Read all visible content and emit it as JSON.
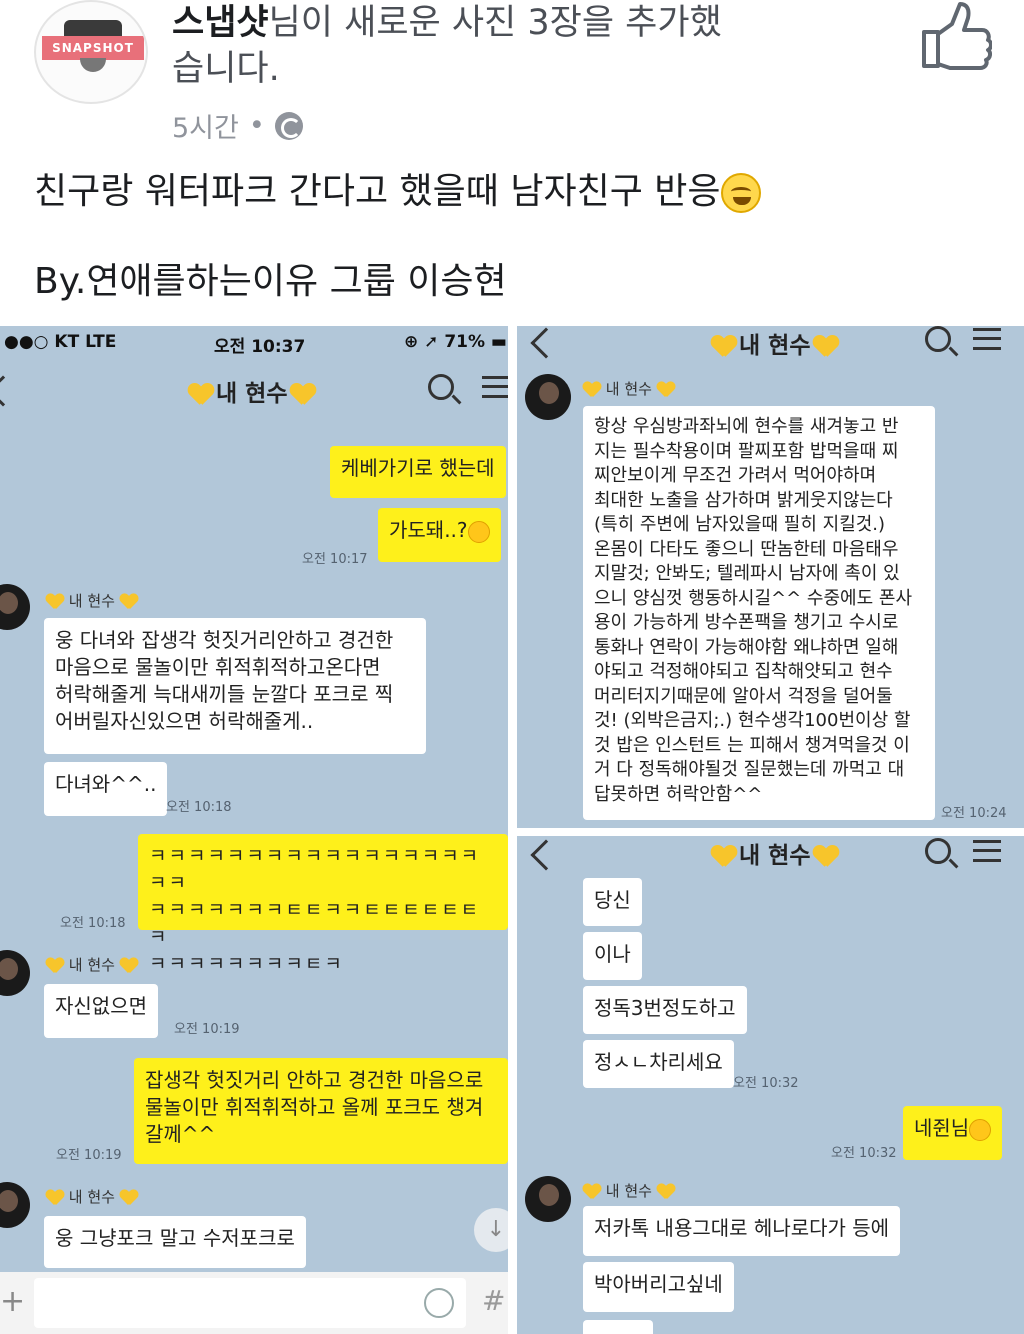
{
  "post": {
    "author": "스냅샷",
    "action": "님이 새로운 사진 3장을 추가했습니다.",
    "avatar_label": "SNAPSHOT",
    "time": "5시간",
    "separator": "•",
    "text": "친구랑 워터파크 간다고 했을때 남자친구 반응",
    "by_line": "By.연애를하는이유 그룹 이승현"
  },
  "left_chat": {
    "status": {
      "carrier": "●●○ KT  LTE",
      "time": "오전 10:37",
      "battery": "⊕ ➚ 71% ▬"
    },
    "title": "내 현수",
    "messages": [
      {
        "text": "케베가기로 했는데",
        "time": ""
      },
      {
        "text": "가도돼..?",
        "time": "오전 10:17"
      },
      {
        "sender": "내 현수",
        "text": "웅 다녀와 잡생각 헛짓거리안하고 경건한\n마음으로 물놀이만 휘적휘적하고온다면\n허락해줄게 늑대새끼들 눈깔다 포크로 찍\n어버릴자신있으면 허락해줄게..",
        "time": ""
      },
      {
        "text": "다녀와^^..",
        "time": "오전 10:18"
      },
      {
        "text": "ㅋㅋㅋㅋㅋㅋㅋㅋㅋㅋㅋㅋㅋㅋㅋㅋㅋㅋㅋ\nㅋㅋㅋㅋㅋㅋㅋㅌㅌㅋㅋㅌㅌㅌㅌㅌㅌㅋ\nㅋㅋㅋㅋㅋㅋㅋㅋㅌㅋ",
        "time": "오전 10:18"
      },
      {
        "sender": "내 현수",
        "text": "자신없으면",
        "time": "오전 10:19"
      },
      {
        "text": "잡생각 헛짓거리 안하고 경건한 마음으로\n물놀이만 휘적휘적하고 올께 포크도 챙겨\n갈께^^",
        "time": "오전 10:19"
      },
      {
        "sender": "내 현수",
        "text": "웅 그냥포크 말고 수저포크로",
        "time": ""
      }
    ],
    "scroll_icon": "↓",
    "plus_icon": "+",
    "hash_icon": "#"
  },
  "right_top_chat": {
    "title": "내 현수",
    "sender": "내 현수",
    "message": "항상 우심방과좌뇌에 현수를 새겨놓고 반\n지는 필수착용이며 팔찌포함 밥먹을때 찌\n찌안보이게 무조건 가려서 먹어야하며\n최대한 노출을 삼가하며 밝게웃지않는다\n(특히 주변에 남자있을때 필히 지킬것.)\n온몸이 다타도 좋으니 딴놈한테 마음태우\n지말것; 안봐도; 텔레파시 남자에 촉이 있\n으니 양심껏 행동하시길^^ 수중에도 폰사\n용이 가능하게 방수폰팩을 챙기고 수시로\n통화나 연락이 가능해야함 왜냐하면 일해\n야되고 걱정해야되고 집착해얏되고 현수\n머리터지기때문에 알아서 걱정을 덜어둘\n것! (외박은금지;.) 현수생각100번이상 할\n것 밥은 인스턴트 는 피해서 챙겨먹을것 이\n거 다 정독해야될것 질문했는데 까먹고 대\n답못하면 허락안함^^",
    "time": "오전 10:24"
  },
  "right_bottom_chat": {
    "title": "내 현수",
    "them_messages": [
      "당신",
      "이나",
      "정독3번정도하고",
      "정ㅅㄴ차리세요"
    ],
    "them_time": "오전 10:32",
    "me_message": "네쥔님",
    "me_time": "오전 10:32",
    "sender": "내 현수",
    "last_messages": [
      "저카톡 내용그대로 헤나로다가 등에",
      "박아버리고싶네"
    ]
  },
  "colors": {
    "chat_bg": "#b2c7d9",
    "my_bubble": "#fef01b",
    "their_bubble": "#ffffff",
    "heart": "#f7c52b"
  }
}
